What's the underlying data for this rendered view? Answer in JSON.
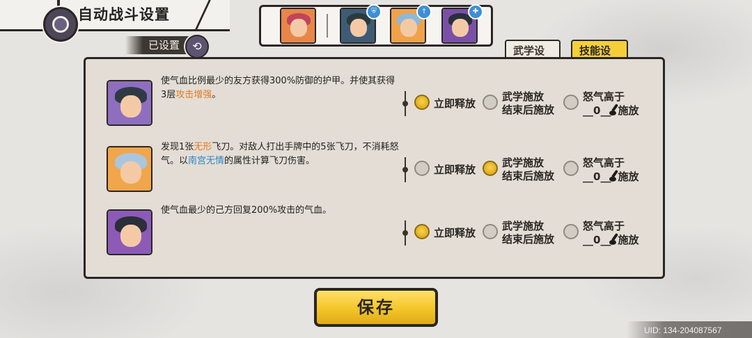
{
  "header": {
    "title": "自动战斗设置",
    "already_set_label": "已设置"
  },
  "team": {
    "heroes": [
      {
        "name_icon": "hero-portrait-1",
        "color": "#e8864a",
        "hair": "#c0455a",
        "badge": null
      },
      {
        "name_icon": "hero-portrait-2",
        "color": "#3d5b74",
        "hair": "#2a3a3e",
        "badge": "shield-icon",
        "badge_color": "#3c8fd6"
      },
      {
        "name_icon": "hero-portrait-3",
        "color": "#f0a24a",
        "hair": "#8fb8d8",
        "badge": "sword-icon",
        "badge_color": "#3c8fd6"
      },
      {
        "name_icon": "hero-portrait-4",
        "color": "#7a4fa8",
        "hair": "#27303c",
        "badge": "heal-icon",
        "badge_color": "#3c8fd6"
      }
    ]
  },
  "tabs": {
    "martial": "武学设定",
    "skill": "技能设定",
    "active": "skill"
  },
  "options": {
    "immediate": "立即释放",
    "after_martial_line1": "武学施放",
    "after_martial_line2": "结束后施放",
    "rage_line1": "怒气高于",
    "rage_prefix": "__",
    "rage_suffix": "__",
    "rage_cast": "施放"
  },
  "skills": [
    {
      "portrait": {
        "bg": "#8e6fbf",
        "hair": "#2f3b44"
      },
      "desc_parts": [
        "使气血比例最少的友方获得300%防御的护甲。并使其获得3层",
        "攻击增强",
        "。"
      ],
      "selected": "immediate",
      "rage_value": "0"
    },
    {
      "portrait": {
        "bg": "#f1a64c",
        "hair": "#a9c6de"
      },
      "desc_parts": [
        "发现1张",
        "无形",
        "飞刀。对敌人打出手牌中的5张飞刀，不消耗怒气。以",
        "南宫无情",
        "的属性计算飞刀伤害。"
      ],
      "selected": "after_martial",
      "rage_value": "0"
    },
    {
      "portrait": {
        "bg": "#8c5bb8",
        "hair": "#2a2f3a"
      },
      "desc_parts": [
        "使气血最少的己方回复200%攻击的气血。"
      ],
      "selected": "immediate",
      "rage_value": "0"
    }
  ],
  "save_label": "保存",
  "uid": "UID: 134-204087567",
  "colors": {
    "accent_yellow": "#f5cf3a",
    "highlight_orange": "#e07a1e",
    "highlight_blue": "#2f86c7"
  }
}
